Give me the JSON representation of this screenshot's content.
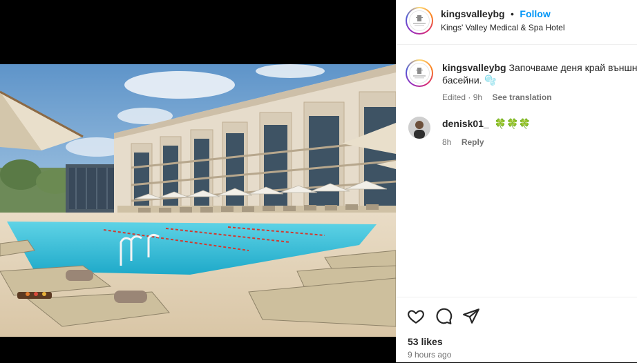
{
  "post": {
    "username": "kingsvalleybg",
    "dot": "•",
    "follow_label": "Follow",
    "location": "Kings' Valley Medical & Spa Hotel",
    "logo_text": "KINGS VALLEY"
  },
  "caption": {
    "username": "kingsvalleybg",
    "text_line1": "Започваме деня край външни",
    "text_line2": "басейни.",
    "emoji": "🫧",
    "edited_time": "Edited · 9h",
    "see_translation": "See translation"
  },
  "comments": [
    {
      "username": "denisk01_",
      "text": "🍀🍀🍀",
      "time": "8h",
      "reply_label": "Reply"
    }
  ],
  "footer": {
    "likes": "53 likes",
    "time_ago": "9 hours ago"
  },
  "icons": {
    "like": "heart-icon",
    "comment": "comment-icon",
    "share": "share-icon"
  },
  "colors": {
    "accent": "#0095f6",
    "text": "#262626",
    "muted": "#737373",
    "pool": "#3ec3dd"
  }
}
